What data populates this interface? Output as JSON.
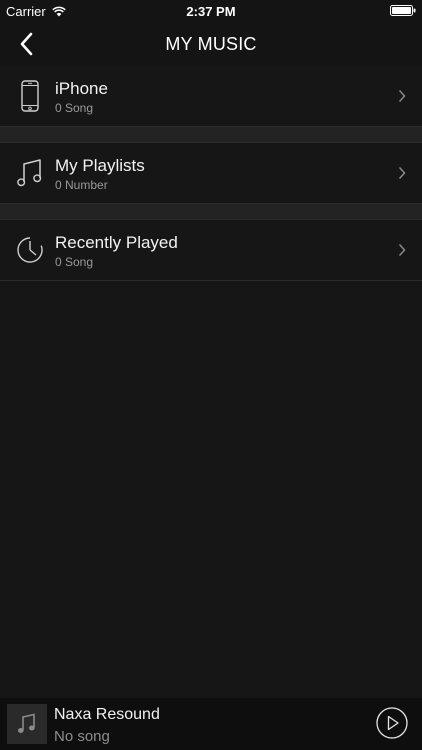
{
  "status_bar": {
    "carrier": "Carrier",
    "time": "2:37 PM"
  },
  "nav": {
    "title": "MY MUSIC",
    "back_icon": "chevron-left-icon"
  },
  "list": {
    "items": [
      {
        "title": "iPhone",
        "subtitle": "0 Song",
        "icon": "phone-icon"
      },
      {
        "title": "My Playlists",
        "subtitle": "0 Number",
        "icon": "music-note-icon"
      },
      {
        "title": "Recently Played",
        "subtitle": "0 Song",
        "icon": "clock-icon"
      }
    ]
  },
  "player": {
    "title": "Naxa Resound",
    "subtitle": "No song",
    "play_icon": "play-icon",
    "art_icon": "music-note-icon"
  },
  "colors": {
    "background": "#161616",
    "divider": "#232323",
    "secondary_text": "#9a9a9a"
  }
}
